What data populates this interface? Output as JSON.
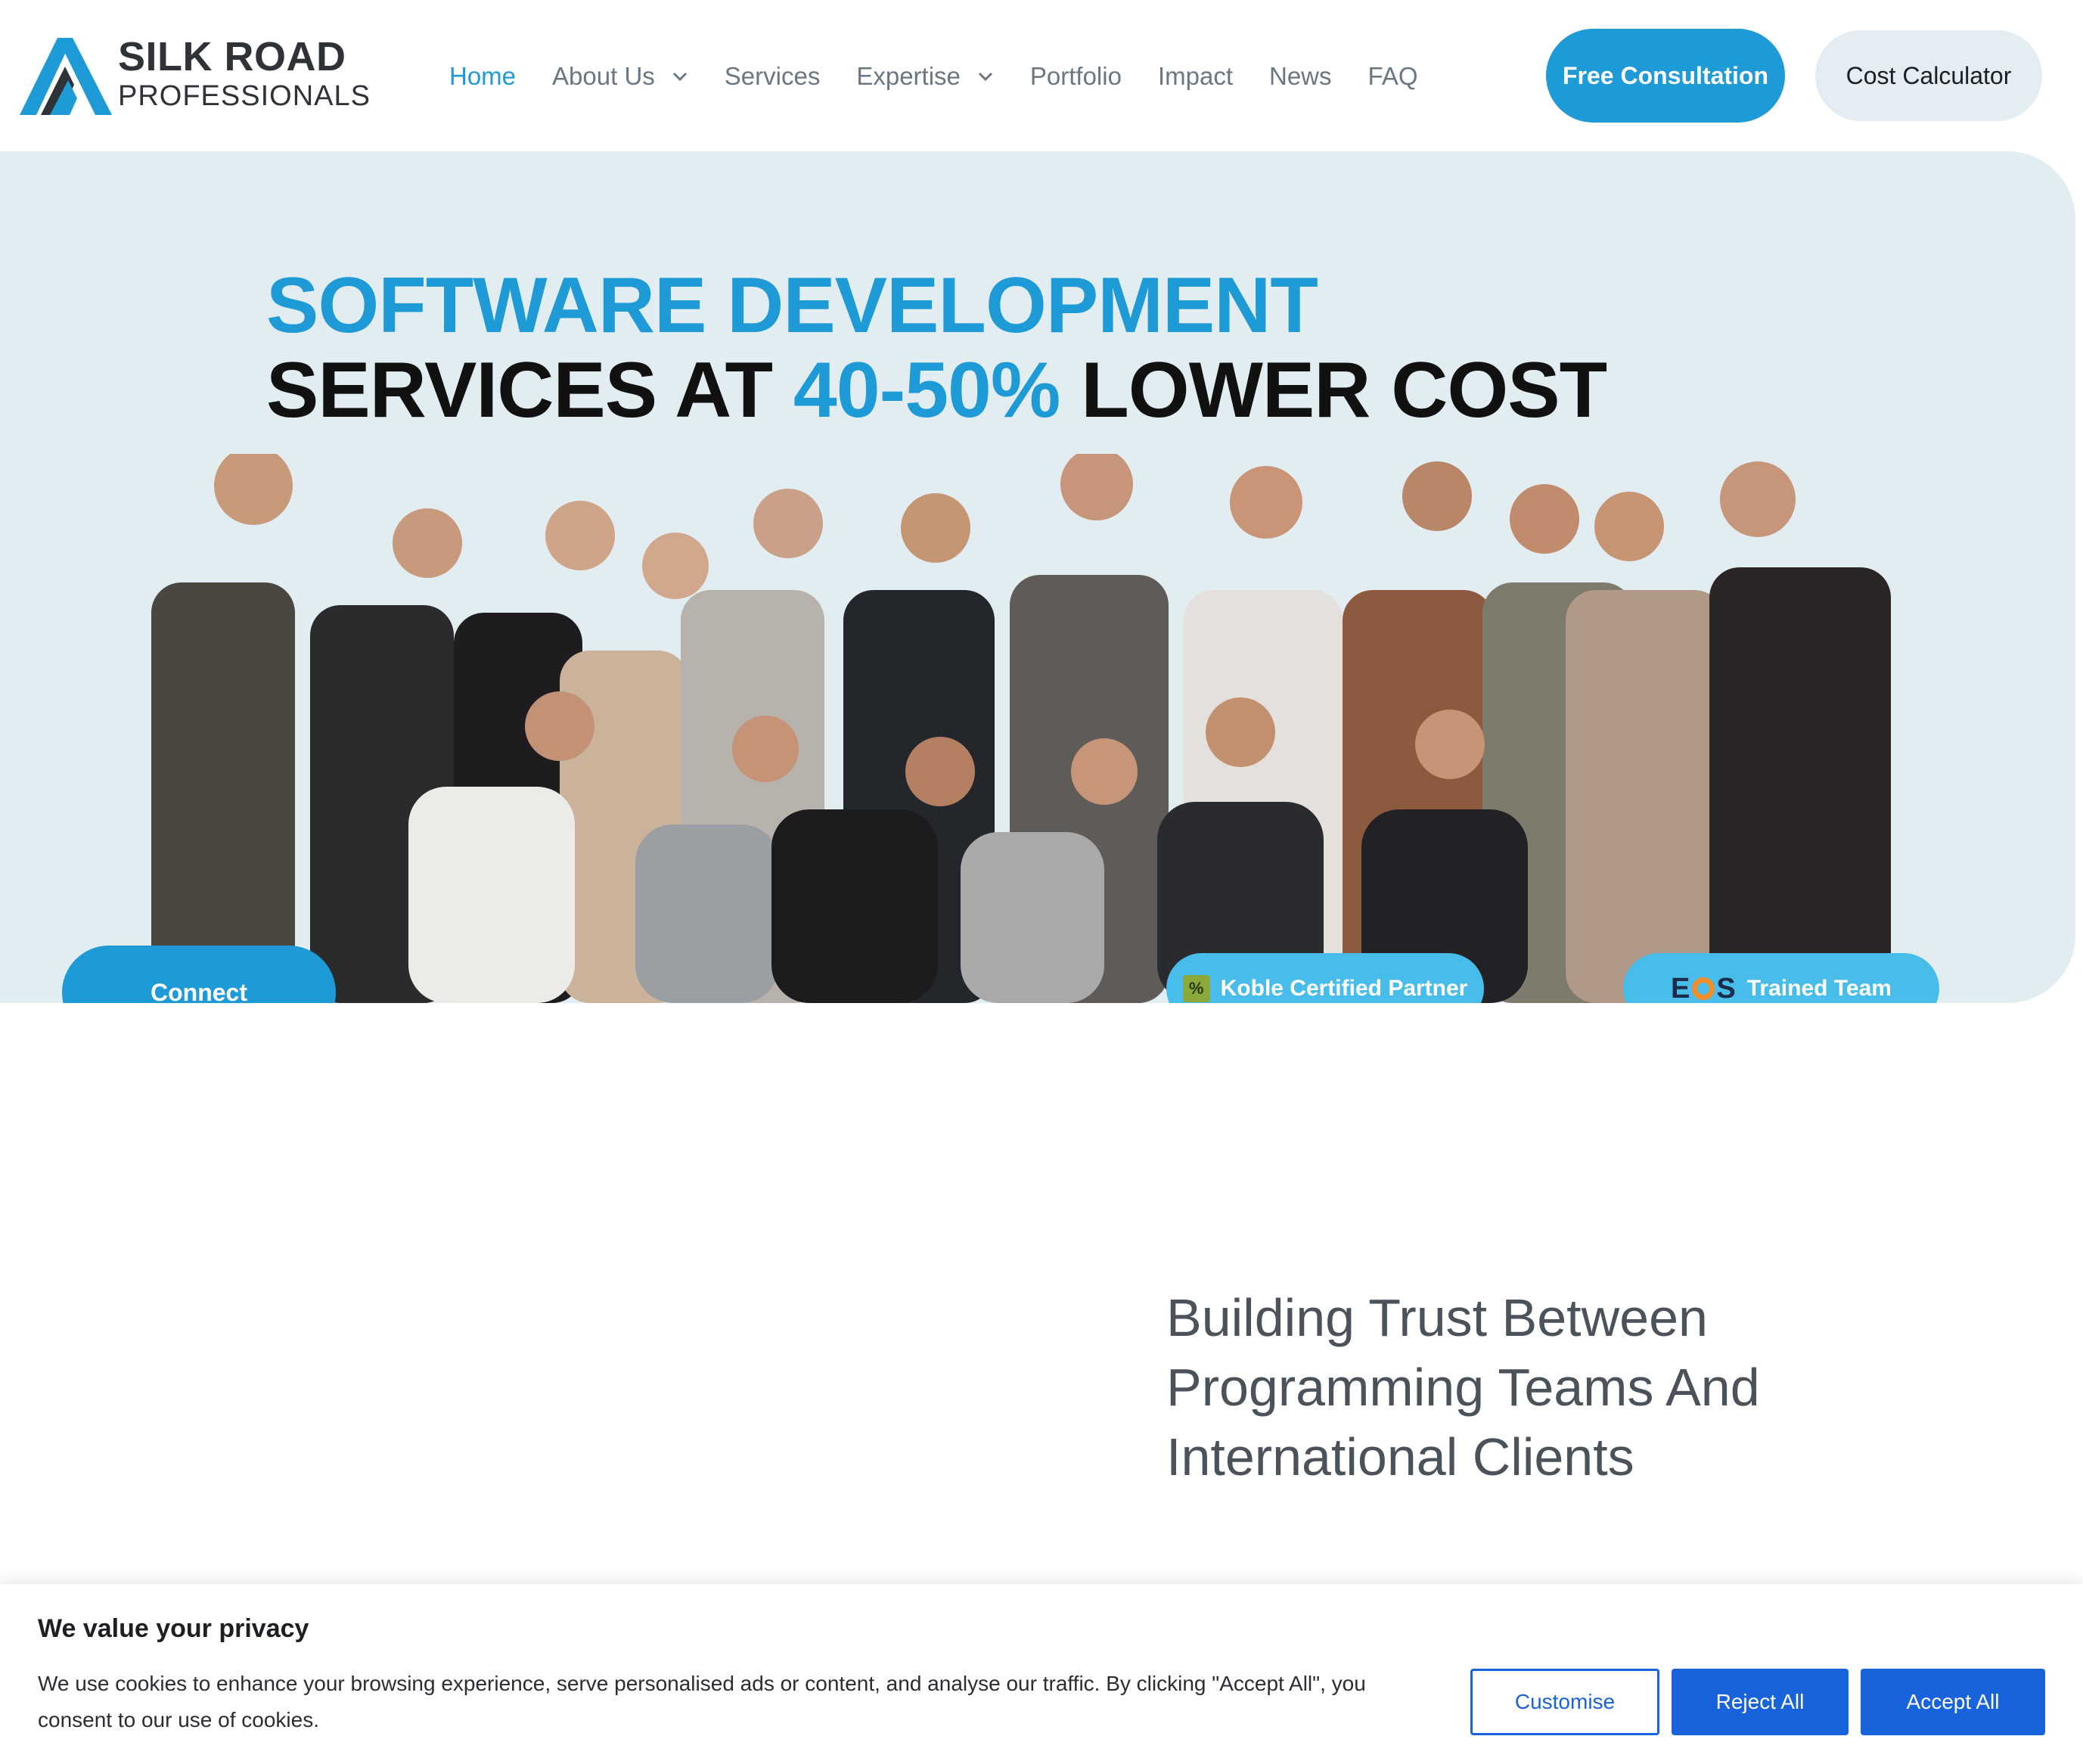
{
  "brand": {
    "name_line1": "SILK ROAD",
    "name_line2": "PROFESSIONALS",
    "color_primary": "#1e9ad6",
    "color_dark": "#2f3338"
  },
  "nav": {
    "items": [
      {
        "label": "Home",
        "active": true,
        "has_dropdown": false
      },
      {
        "label": "About Us",
        "active": false,
        "has_dropdown": true
      },
      {
        "label": "Services",
        "active": false,
        "has_dropdown": false
      },
      {
        "label": "Expertise",
        "active": false,
        "has_dropdown": true
      },
      {
        "label": "Portfolio",
        "active": false,
        "has_dropdown": false
      },
      {
        "label": "Impact",
        "active": false,
        "has_dropdown": false
      },
      {
        "label": "News",
        "active": false,
        "has_dropdown": false
      },
      {
        "label": "FAQ",
        "active": false,
        "has_dropdown": false
      }
    ],
    "consult_label": "Free Consultation",
    "calc_label": "Cost Calculator"
  },
  "hero": {
    "title_line1": "SOFTWARE DEVELOPMENT",
    "title_line2_pre": "SERVICES AT ",
    "title_line2_accent": "40-50%",
    "title_line2_post": " LOWER COST",
    "photo_icon": "team-photo",
    "connect_label": "Connect",
    "badge_koble": "Koble Certified Partner",
    "badge_koble_icon": "koble-logo-icon",
    "badge_eos": "Trained Team",
    "badge_eos_icon_text": "EOS",
    "background": "#e2edf1"
  },
  "section": {
    "heading": "Building Trust Between Programming Teams And International Clients"
  },
  "cookie": {
    "title": "We value your privacy",
    "text": "We use cookies to enhance your browsing experience, serve personalised ads or content, and analyse our traffic. By clicking \"Accept All\", you consent to our use of cookies.",
    "customise_label": "Customise",
    "reject_label": "Reject All",
    "accept_label": "Accept All",
    "button_color": "#1863dc"
  }
}
